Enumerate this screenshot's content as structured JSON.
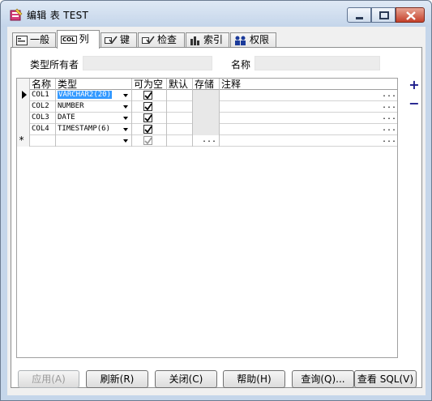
{
  "window": {
    "title": "编辑 表 TEST"
  },
  "tabs": [
    {
      "label": "一般",
      "icon": "general-icon"
    },
    {
      "label": "列",
      "icon": "column-icon",
      "icon_text": "COL"
    },
    {
      "label": "键",
      "icon": "key-icon"
    },
    {
      "label": "检查",
      "icon": "check-icon"
    },
    {
      "label": "索引",
      "icon": "index-icon"
    },
    {
      "label": "权限",
      "icon": "privileges-icon"
    }
  ],
  "fields": {
    "owner_label": "类型所有者",
    "owner_value": "",
    "name_label": "名称",
    "name_value": ""
  },
  "grid": {
    "headers": [
      "名称",
      "类型",
      "可为空",
      "默认",
      "存储",
      "注释"
    ],
    "rows": [
      {
        "name": "COL1",
        "type": "VARCHAR2(20)",
        "nullable": true,
        "current": true
      },
      {
        "name": "COL2",
        "type": "NUMBER",
        "nullable": true
      },
      {
        "name": "COL3",
        "type": "DATE",
        "nullable": true
      },
      {
        "name": "COL4",
        "type": "TIMESTAMP(6)",
        "nullable": true
      }
    ],
    "new_row_marker": "*",
    "ellipsis": "..."
  },
  "side_buttons": {
    "add": "+",
    "remove": "−"
  },
  "buttons": {
    "apply": "应用(A)",
    "refresh": "刷新(R)",
    "close": "关闭(C)",
    "help": "帮助(H)",
    "query": "查询(Q)...",
    "view_sql": "查看 SQL(V)"
  },
  "colors": {
    "selection": "#3399ff",
    "title_bg": "#c4d5ea",
    "close_button": "#c4402a"
  }
}
